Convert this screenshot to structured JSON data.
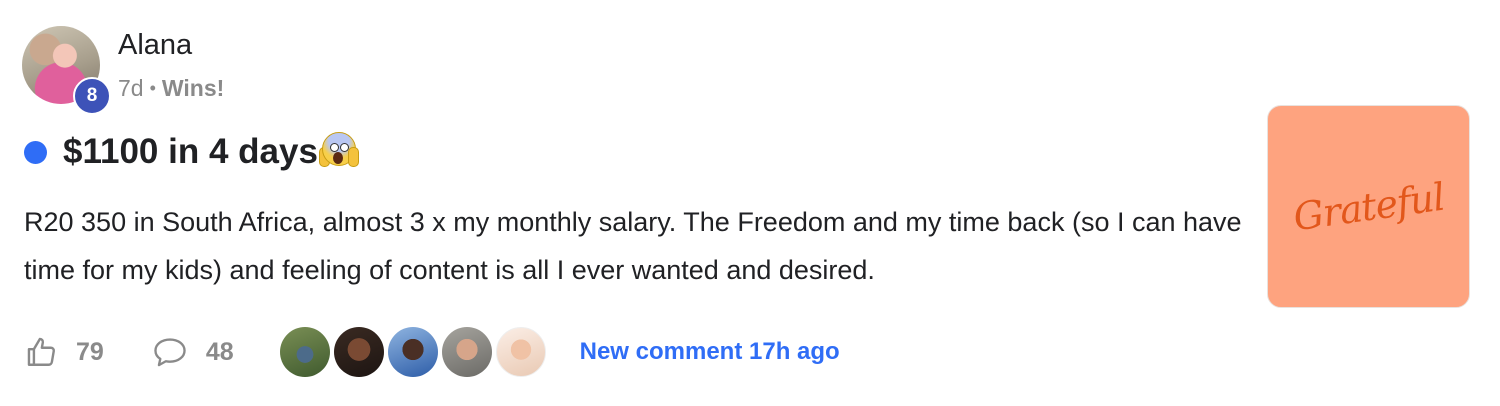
{
  "post": {
    "author": "Alana",
    "level": "8",
    "time_ago": "7d",
    "separator": "•",
    "category": "Wins!",
    "title": "$1100 in 4 days",
    "title_emoji": "face-screaming-in-fear-emoji",
    "body": "R20 350 in South Africa, almost 3 x my monthly salary. The Freedom and my time back (so I can have time for my kids) and feeling of content is all I ever wanted and desired.",
    "thumbnail_text": "Grateful",
    "unread": true
  },
  "footer": {
    "likes": "79",
    "comments": "48",
    "commenter_count_shown": 5,
    "new_comment_label": "New comment 17h ago"
  },
  "colors": {
    "accent_blue": "#2f6df6",
    "level_badge": "#3d52b8",
    "thumbnail_bg": "#fea37f",
    "thumbnail_text": "#e2571b",
    "muted_text": "#8a8a8a"
  },
  "icons": {
    "like": "thumbs-up-icon",
    "comment": "speech-bubble-icon"
  }
}
